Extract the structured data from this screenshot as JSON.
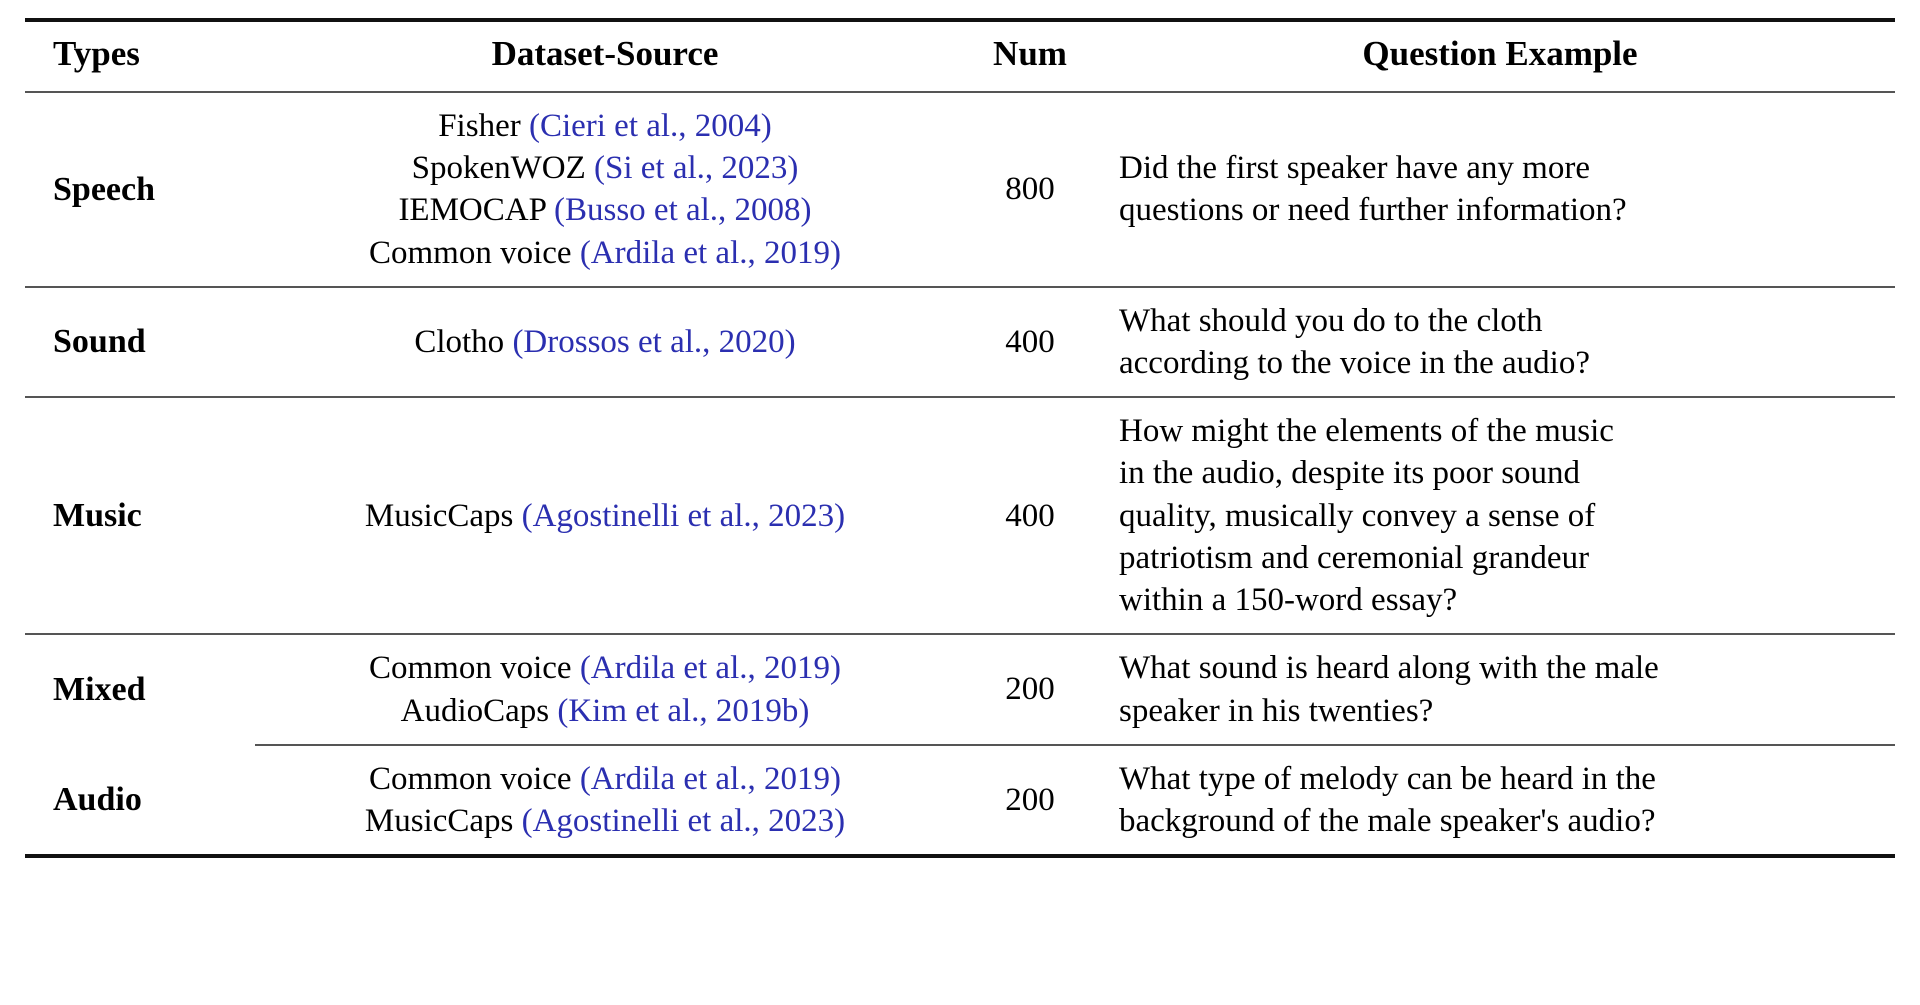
{
  "table": {
    "columns": [
      {
        "key": "types",
        "label": "Types"
      },
      {
        "key": "dataset_source",
        "label": "Dataset-Source"
      },
      {
        "key": "num",
        "label": "Num"
      },
      {
        "key": "question_example",
        "label": "Question Example"
      }
    ],
    "citation_color": "#2b2fb0",
    "rule_color_thick": "#111111",
    "rule_color_thin": "#555555",
    "rows": [
      {
        "type": "Speech",
        "num": "800",
        "sources": [
          {
            "name": "Fisher",
            "citation": "(Cieri et al., 2004)"
          },
          {
            "name": "SpokenWOZ",
            "citation": "(Si et al., 2023)"
          },
          {
            "name": "IEMOCAP",
            "citation": "(Busso et al., 2008)"
          },
          {
            "name": "Common voice",
            "citation": "(Ardila et al., 2019)"
          }
        ],
        "question_lines": [
          "Did the first speaker have any more",
          "questions or need further information?"
        ],
        "separator": "full"
      },
      {
        "type": "Sound",
        "num": "400",
        "sources": [
          {
            "name": "Clotho",
            "citation": "(Drossos et al., 2020)"
          }
        ],
        "question_lines": [
          "What should you do to the cloth",
          "according to the voice in the audio?"
        ],
        "separator": "full"
      },
      {
        "type": "Music",
        "num": "400",
        "sources": [
          {
            "name": "MusicCaps",
            "citation": "(Agostinelli et al., 2023)"
          }
        ],
        "question_lines": [
          "How might the elements of the music",
          "in the audio, despite its poor sound",
          "quality, musically convey a sense of",
          "patriotism and ceremonial grandeur",
          "within a 150-word essay?"
        ],
        "separator": "full"
      },
      {
        "type": "Mixed",
        "num": "200",
        "sources": [
          {
            "name": "Common voice",
            "citation": "(Ardila et al., 2019)"
          },
          {
            "name": "AudioCaps",
            "citation": "(Kim et al., 2019b)"
          }
        ],
        "question_lines": [
          "What sound is heard along with the male",
          "speaker in his twenties?"
        ],
        "separator": "full"
      },
      {
        "type": "Audio",
        "num": "200",
        "sources": [
          {
            "name": "Common voice",
            "citation": "(Ardila et al., 2019)"
          },
          {
            "name": "MusicCaps",
            "citation": "(Agostinelli et al., 2023)"
          }
        ],
        "question_lines": [
          "What type of melody can be heard in the",
          "background of the male speaker's audio?"
        ],
        "separator": "partial"
      }
    ]
  }
}
